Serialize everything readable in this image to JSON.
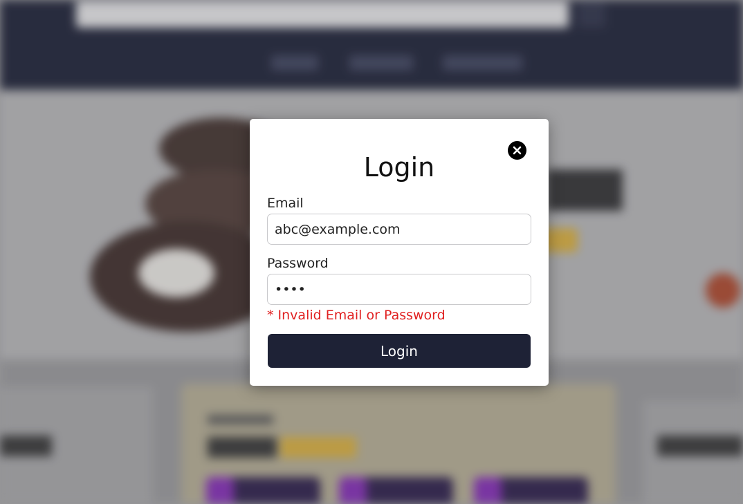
{
  "modal": {
    "title": "Login",
    "close_icon": "close-circle-icon",
    "email_label": "Email",
    "email_value": "abc@example.com",
    "password_label": "Password",
    "password_value": "abcd",
    "error_message": "* Invalid Email or Password",
    "submit_label": "Login"
  },
  "colors": {
    "header_bg": "#1b1f33",
    "button_bg": "#1e2236",
    "error_text": "#e02020"
  }
}
